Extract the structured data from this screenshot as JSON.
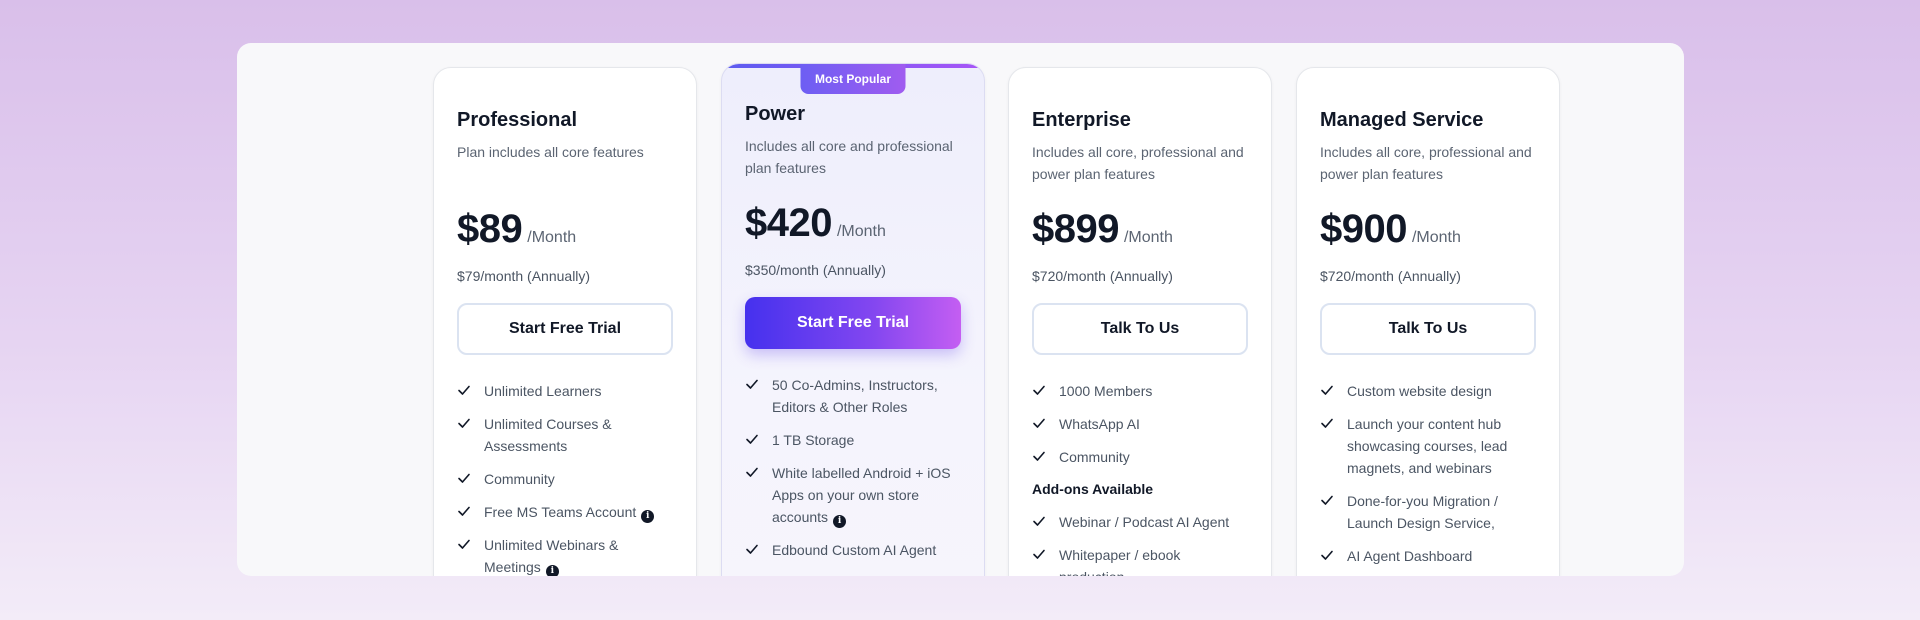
{
  "badge": "Most Popular",
  "plans": [
    {
      "name": "Professional",
      "description": "Plan includes all core features",
      "price": "$89",
      "period": "/Month",
      "annual": "$79/month (Annually)",
      "cta": "Start Free Trial",
      "features": [
        "Unlimited Learners",
        "Unlimited Courses & Assessments",
        "Community",
        "Free MS Teams Account",
        "Unlimited Webinars & Meetings"
      ]
    },
    {
      "name": "Power",
      "description": "Includes all core and professional plan features",
      "price": "$420",
      "period": "/Month",
      "annual": "$350/month (Annually)",
      "cta": "Start Free Trial",
      "features": [
        "50 Co-Admins, Instructors, Editors & Other Roles",
        "1 TB Storage",
        "White labelled Android + iOS Apps on your own store accounts",
        "Edbound Custom AI Agent"
      ]
    },
    {
      "name": "Enterprise",
      "description": "Includes all core, professional and power plan features",
      "price": "$899",
      "period": "/Month",
      "annual": "$720/month (Annually)",
      "cta": "Talk To Us",
      "features": [
        "1000 Members",
        "WhatsApp AI",
        "Community"
      ],
      "addons_heading": "Add-ons Available",
      "addons": [
        "Webinar / Podcast AI Agent",
        "Whitepaper / ebook production"
      ]
    },
    {
      "name": "Managed Service",
      "description": "Includes all core, professional and power plan features",
      "price": "$900",
      "period": "/Month",
      "annual": "$720/month (Annually)",
      "cta": "Talk To Us",
      "features": [
        "Custom website design",
        "Launch your content hub showcasing courses, lead magnets, and webinars",
        "Done-for-you Migration / Launch Design Service,",
        "AI Agent Dashboard"
      ]
    }
  ],
  "icons": {
    "check": "check-icon",
    "info": "info-icon"
  },
  "info_glyph": "i",
  "colors": {
    "accent_start": "#4531ee",
    "accent_end": "#c45ef2",
    "text_primary": "#111827",
    "text_muted": "#4b5563"
  }
}
